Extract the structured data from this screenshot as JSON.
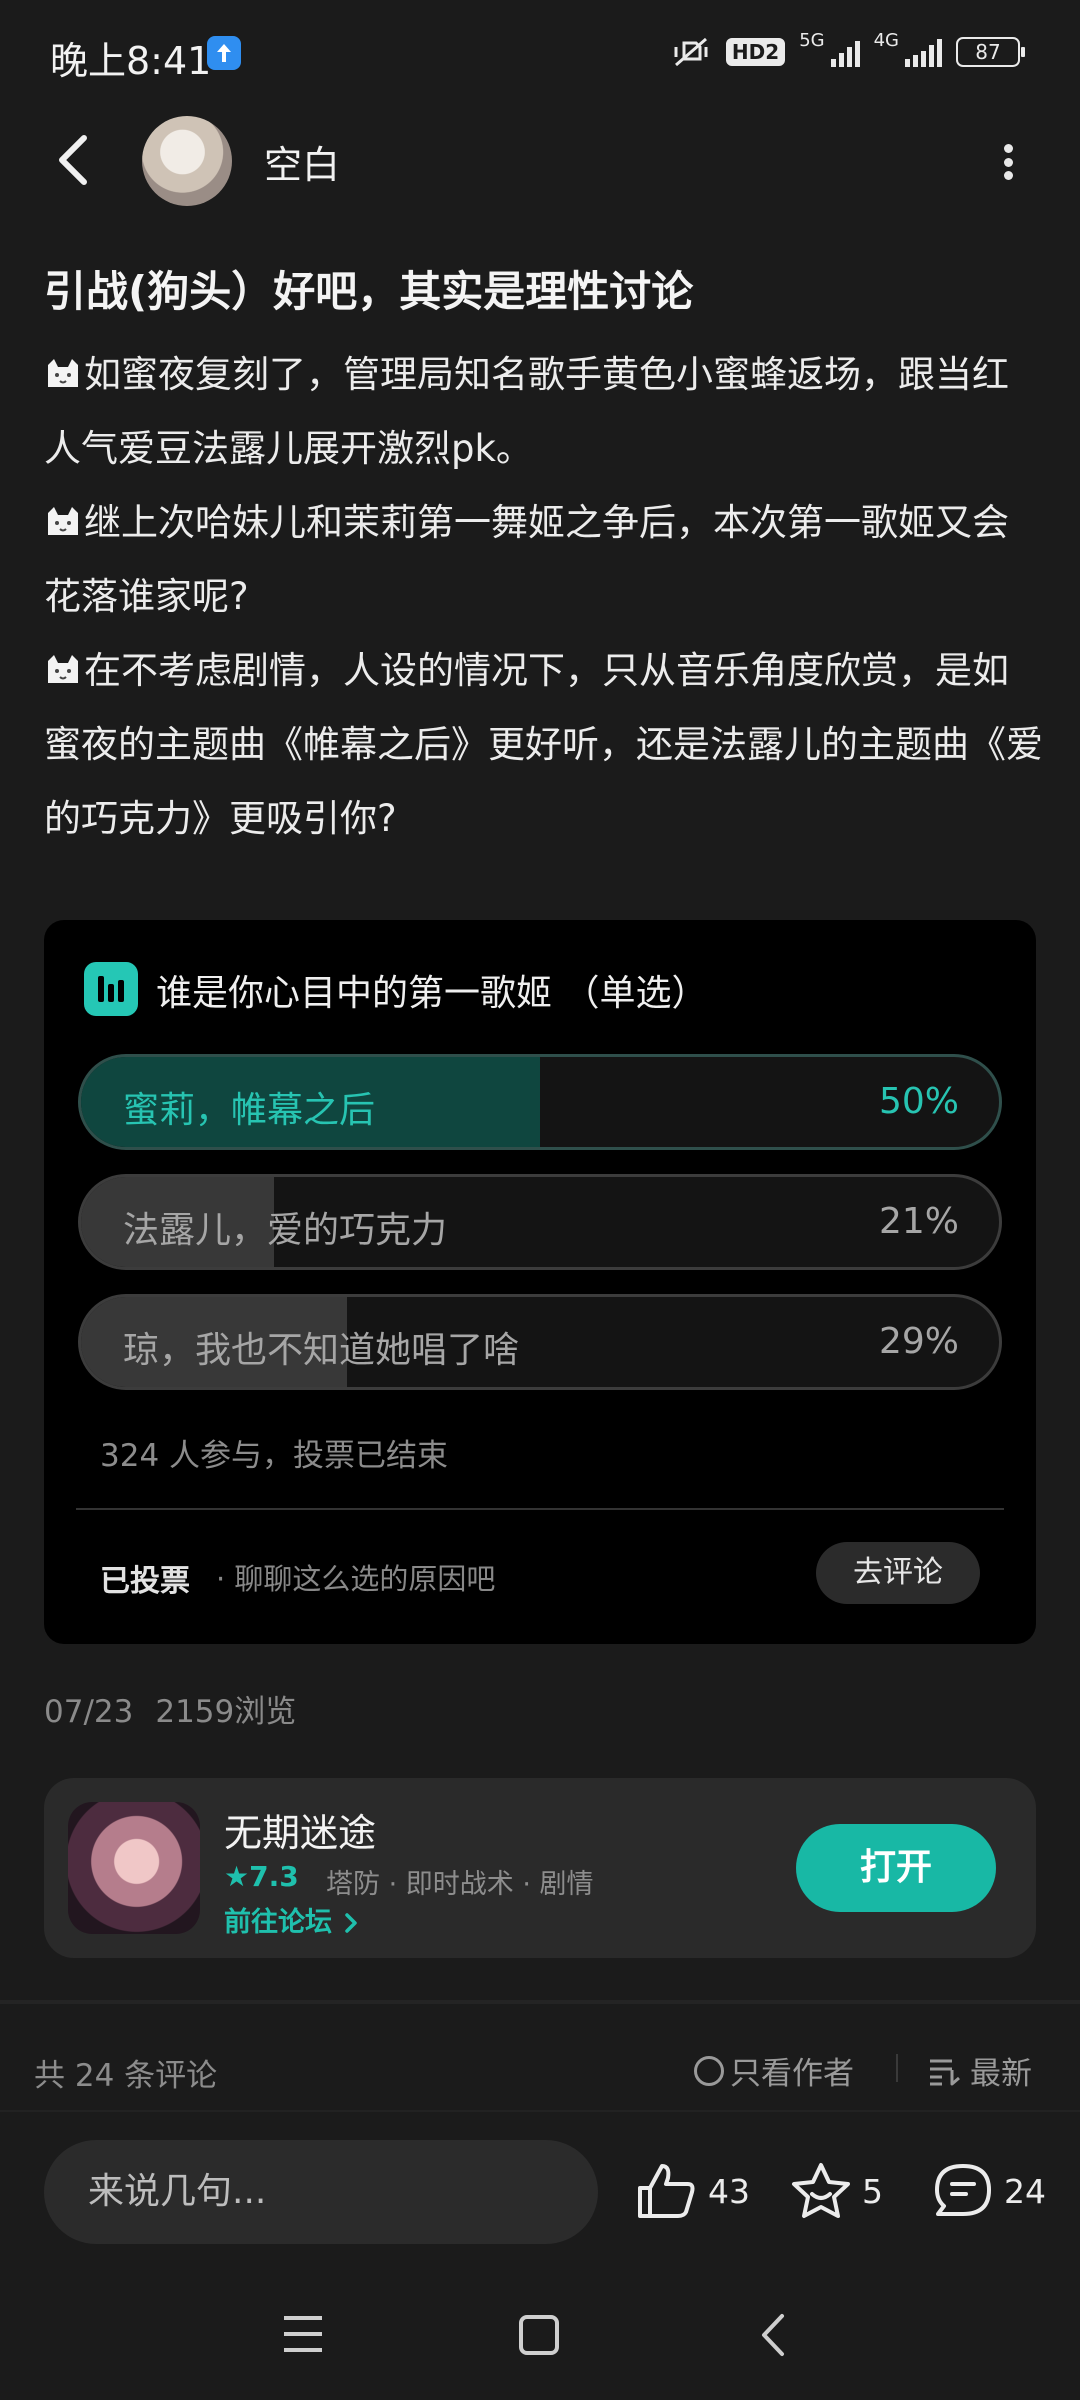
{
  "status_bar": {
    "time": "晚上8:41",
    "hd_badge": "HD2",
    "net_1": "5G",
    "net_2": "4G",
    "battery": "87"
  },
  "header": {
    "author_name": "空白"
  },
  "post": {
    "title": "引战(狗头）好吧，其实是理性讨论",
    "paragraphs": [
      "如蜜夜复刻了，管理局知名歌手黄色小蜜蜂返场，跟当红人气爱豆法露儿展开激烈pk。",
      "继上次哈妹儿和茉莉第一舞姬之争后，本次第一歌姬又会花落谁家呢?",
      "在不考虑剧情，人设的情况下，只从音乐角度欣赏，是如蜜夜的主题曲《帷幕之后》更好听，还是法露儿的主题曲《爱的巧克力》更吸引你?"
    ],
    "date": "07/23",
    "views": "2159浏览"
  },
  "poll": {
    "title": "谁是你心目中的第一歌姬 （单选）",
    "options": [
      {
        "label": "蜜莉，帷幕之后",
        "percent_text": "50%",
        "percent": 50,
        "selected": true
      },
      {
        "label": "法露儿，爱的巧克力",
        "percent_text": "21%",
        "percent": 21,
        "selected": false
      },
      {
        "label": "琼，我也不知道她唱了啥",
        "percent_text": "29%",
        "percent": 29,
        "selected": false
      }
    ],
    "meta": "324 人参与，投票已结束",
    "voted_label": "已投票",
    "voted_hint": "· 聊聊这么选的原因吧",
    "comment_button": "去评论"
  },
  "game": {
    "name": "无期迷途",
    "rating": "7.3",
    "tags": "塔防 · 即时战术 · 剧情",
    "forum_link": "前往论坛",
    "open_button": "打开"
  },
  "comments": {
    "count_text": "共 24 条评论",
    "only_author": "只看作者",
    "sort_label": "最新"
  },
  "bottom_bar": {
    "input_placeholder": "来说几句...",
    "likes": "43",
    "favorites": "5",
    "comments": "24"
  },
  "colors": {
    "accent": "#1fc0ad",
    "background": "#1b1b1b",
    "card": "#000000"
  }
}
